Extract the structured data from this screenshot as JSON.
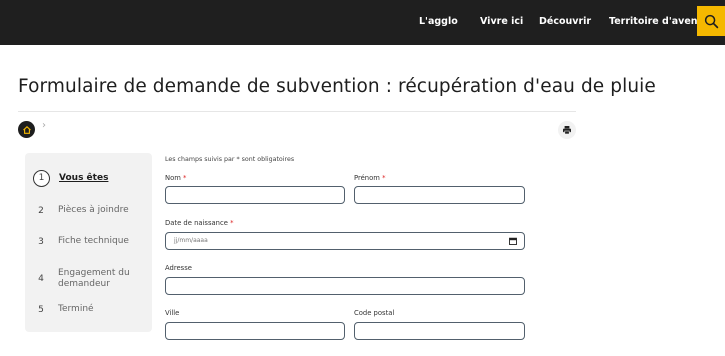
{
  "nav": {
    "items": [
      "L'agglo",
      "Vivre ici",
      "Découvrir",
      "Territoire d'avenir"
    ]
  },
  "page": {
    "title": "Formulaire de demande de subvention : récupération d'eau de pluie",
    "breadcrumb_sep": "›"
  },
  "steps": [
    {
      "num": "1",
      "label": "Vous êtes",
      "active": true
    },
    {
      "num": "2",
      "label": "Pièces à joindre"
    },
    {
      "num": "3",
      "label": "Fiche technique"
    },
    {
      "num": "4",
      "label": "Engagement du demandeur"
    },
    {
      "num": "5",
      "label": "Terminé"
    }
  ],
  "form": {
    "required_note": "Les champs suivis par * sont obligatoires",
    "required_mark": "*",
    "nom": "Nom",
    "prenom": "Prénom",
    "date_naissance": "Date de naissance",
    "date_placeholder": "jj/mm/aaaa",
    "adresse": "Adresse",
    "ville": "Ville",
    "code_postal": "Code postal"
  },
  "colors": {
    "topbar": "#1f1f1f",
    "accent": "#f5b800",
    "required": "#dd2222"
  },
  "icons": {
    "search": "search-icon",
    "home": "home-icon",
    "print": "print-icon",
    "calendar": "calendar-icon"
  }
}
